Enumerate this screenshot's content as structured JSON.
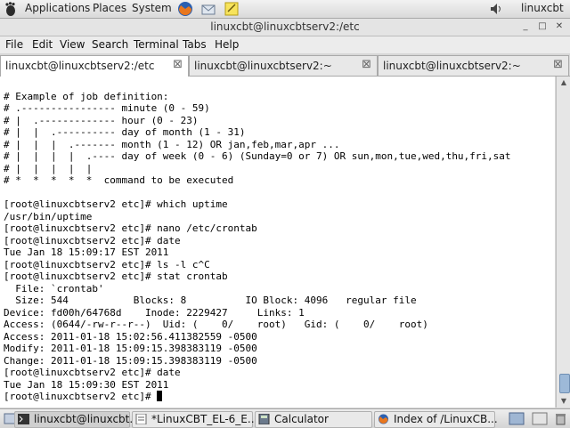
{
  "top_panel": {
    "menus": [
      "Applications",
      "Places",
      "System"
    ],
    "username": "linuxcbt",
    "launchers": [
      "firefox-icon",
      "mail-icon",
      "notes-icon"
    ],
    "tray": [
      "volume-icon"
    ]
  },
  "window": {
    "title": "linuxcbt@linuxcbtserv2:/etc"
  },
  "menubar": {
    "items": [
      "File",
      "Edit",
      "View",
      "Search",
      "Terminal",
      "Tabs",
      "Help"
    ]
  },
  "tabs": [
    {
      "label": "linuxcbt@linuxcbtserv2:/etc",
      "active": true
    },
    {
      "label": "linuxcbt@linuxcbtserv2:~",
      "active": false
    },
    {
      "label": "linuxcbt@linuxcbtserv2:~",
      "active": false
    }
  ],
  "terminal": {
    "lines": [
      "",
      "# Example of job definition:",
      "# .---------------- minute (0 - 59)",
      "# |  .------------- hour (0 - 23)",
      "# |  |  .---------- day of month (1 - 31)",
      "# |  |  |  .------- month (1 - 12) OR jan,feb,mar,apr ...",
      "# |  |  |  |  .---- day of week (0 - 6) (Sunday=0 or 7) OR sun,mon,tue,wed,thu,fri,sat",
      "# |  |  |  |  |",
      "# *  *  *  *  *  command to be executed",
      "",
      "[root@linuxcbtserv2 etc]# which uptime",
      "/usr/bin/uptime",
      "[root@linuxcbtserv2 etc]# nano /etc/crontab",
      "[root@linuxcbtserv2 etc]# date",
      "Tue Jan 18 15:09:17 EST 2011",
      "[root@linuxcbtserv2 etc]# ls -l c^C",
      "[root@linuxcbtserv2 etc]# stat crontab",
      "  File: `crontab'",
      "  Size: 544           Blocks: 8          IO Block: 4096   regular file",
      "Device: fd00h/64768d    Inode: 2229427     Links: 1",
      "Access: (0644/-rw-r--r--)  Uid: (    0/    root)   Gid: (    0/    root)",
      "Access: 2011-01-18 15:02:56.411382559 -0500",
      "Modify: 2011-01-18 15:09:15.398383119 -0500",
      "Change: 2011-01-18 15:09:15.398383119 -0500",
      "[root@linuxcbtserv2 etc]# date",
      "Tue Jan 18 15:09:30 EST 2011"
    ],
    "prompt": "[root@linuxcbtserv2 etc]# "
  },
  "taskbar": [
    {
      "label": "linuxcbt@linuxcbt...",
      "icon": "terminal-icon",
      "active": true
    },
    {
      "label": "*LinuxCBT_EL-6_E...",
      "icon": "text-editor-icon",
      "active": false
    },
    {
      "label": "Calculator",
      "icon": "calculator-icon",
      "active": false
    },
    {
      "label": "Index of /LinuxCB...",
      "icon": "firefox-icon",
      "active": false
    }
  ],
  "colors": {
    "terminal_bg": "#ffffff",
    "terminal_fg": "#000000",
    "panel_bg": "#e0e0e0"
  }
}
